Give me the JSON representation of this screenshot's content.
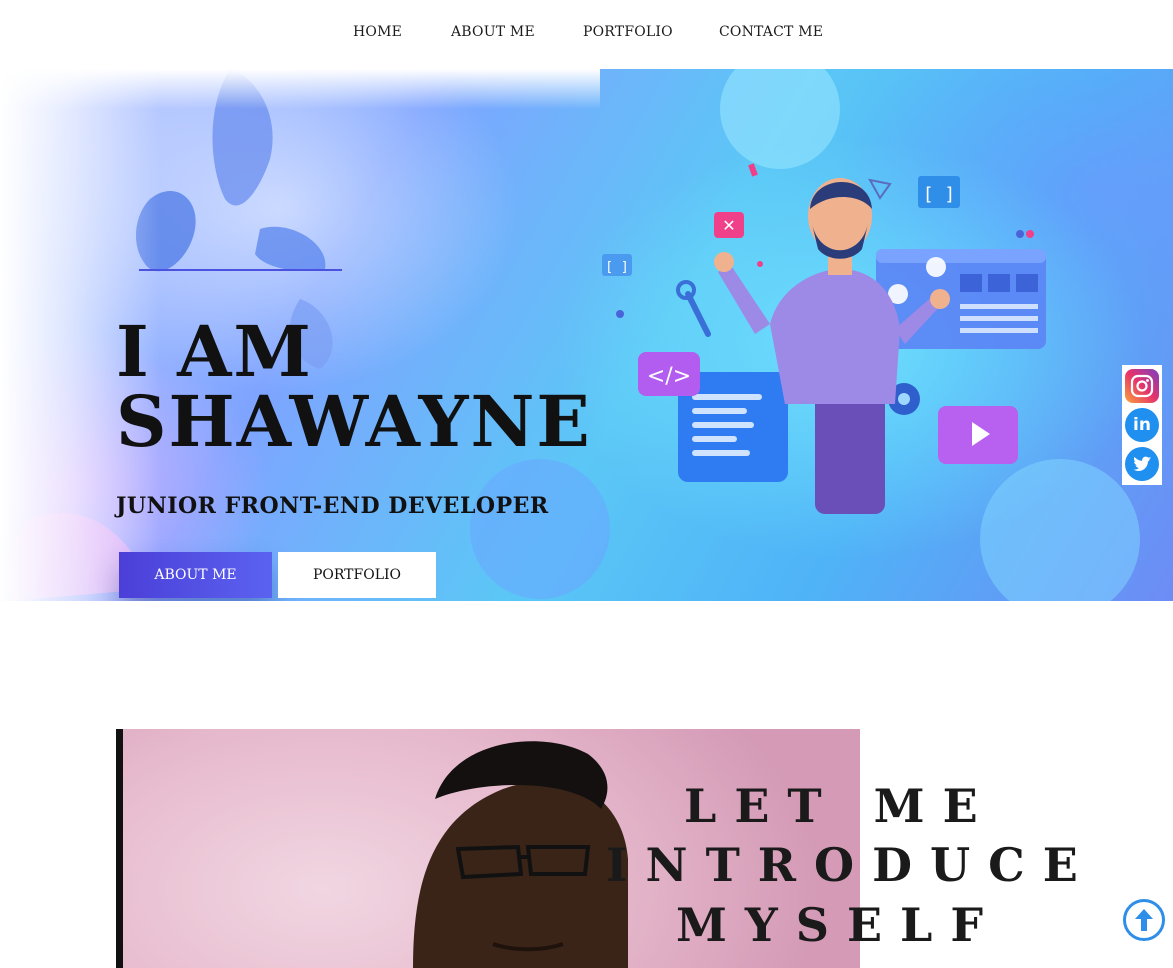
{
  "nav": {
    "items": [
      {
        "label": "HOME"
      },
      {
        "label": "ABOUT ME"
      },
      {
        "label": "PORTFOLIO"
      },
      {
        "label": "CONTACT ME"
      }
    ]
  },
  "hero": {
    "title_line1": "I AM",
    "title_line2": "SHAWAYNE",
    "subtitle": "JUNIOR FRONT-END DEVELOPER",
    "buttons": {
      "about": "ABOUT ME",
      "portfolio": "PORTFOLIO"
    },
    "colors": {
      "accent": "#4b52e0",
      "button_primary": "#4b3fd8"
    }
  },
  "social": {
    "items": [
      {
        "name": "instagram-icon"
      },
      {
        "name": "linkedin-icon"
      },
      {
        "name": "twitter-icon"
      }
    ]
  },
  "about": {
    "heading_line1": "LET ME",
    "heading_line2": "INTRODUCE",
    "heading_line3": "MYSELF"
  },
  "back_to_top": {
    "icon": "arrow-up-icon",
    "color": "#2f8ee8"
  }
}
